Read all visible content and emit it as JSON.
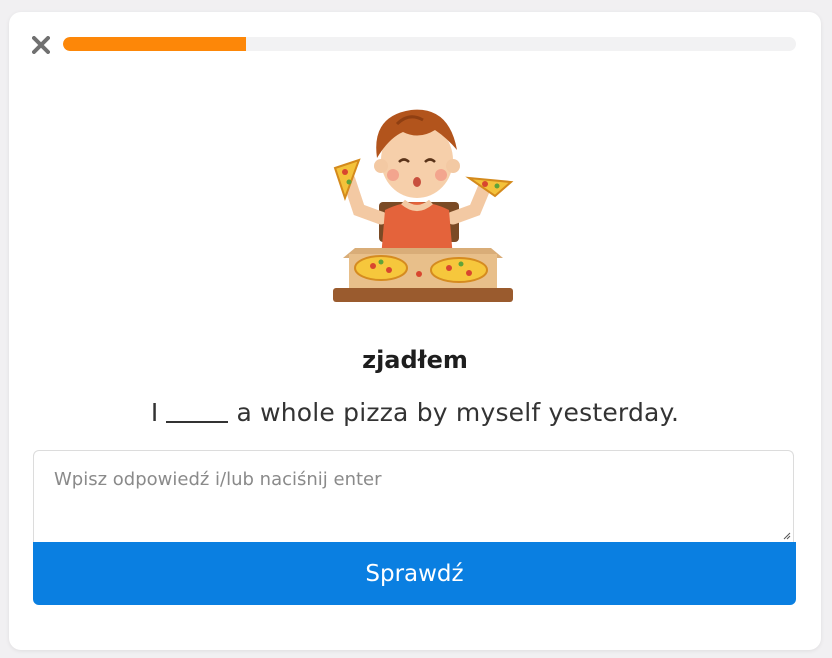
{
  "header": {
    "close_icon": "close-icon",
    "progress_fraction": 0.25,
    "progress_color": "#fd8708"
  },
  "illustration": {
    "icon": "boy-eating-pizza-illustration"
  },
  "question": {
    "word": "zjadłem",
    "sentence_before": "I",
    "sentence_after": "a whole pizza by myself yesterday."
  },
  "answer": {
    "value": "",
    "placeholder": "Wpisz odpowiedź i/lub naciśnij enter"
  },
  "actions": {
    "check_label": "Sprawdź",
    "check_color": "#0a7fe1"
  }
}
